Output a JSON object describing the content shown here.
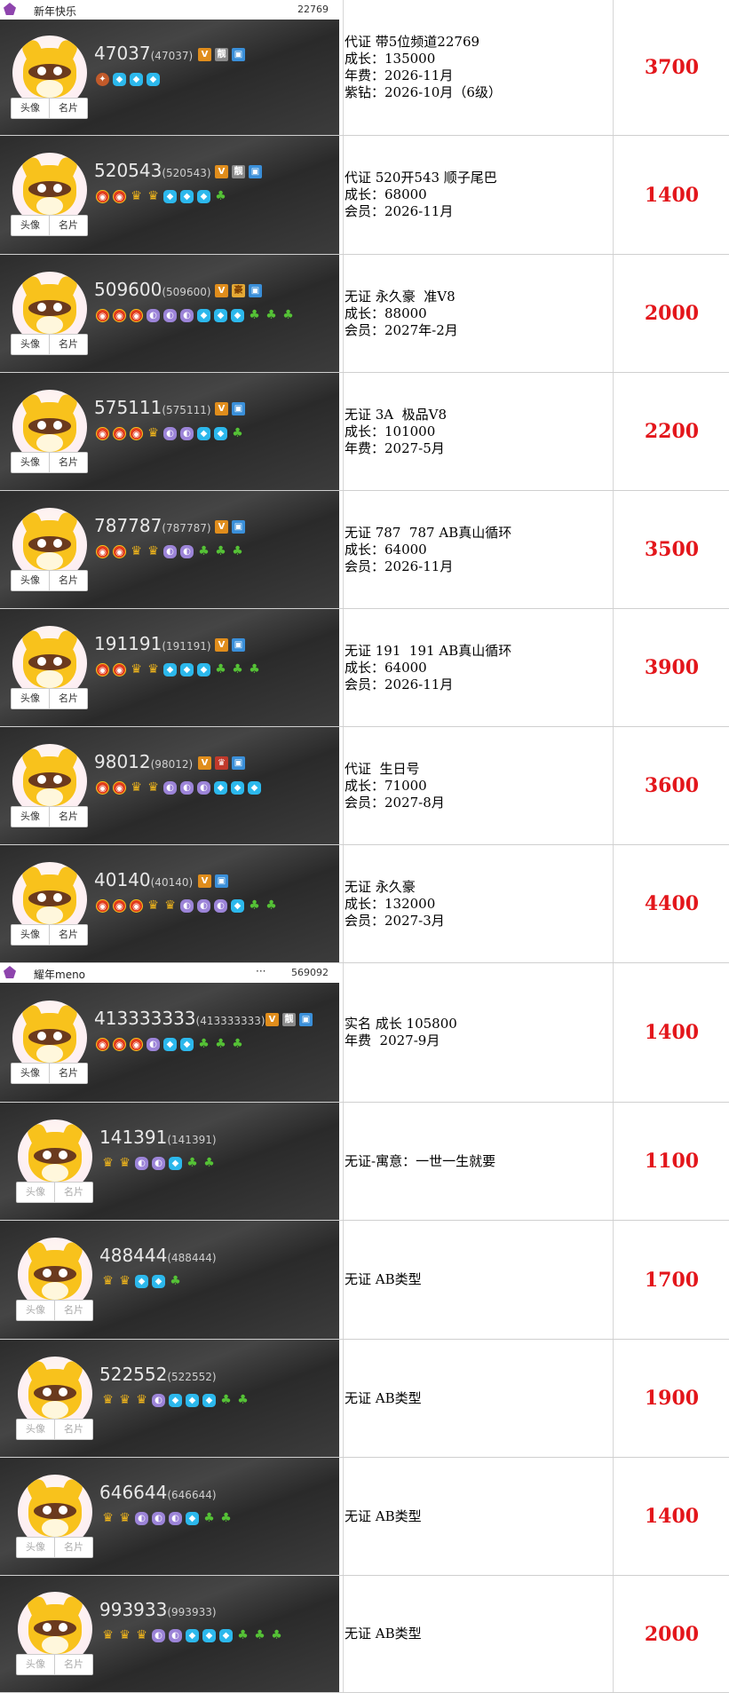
{
  "colors": {
    "price": "#e3161b",
    "dark_bg": "#2f2f2f"
  },
  "rows": [
    {
      "topbar": {
        "nick": "新年快乐",
        "num": "22769"
      },
      "uid": "47037",
      "uid_paren": "(47037)",
      "tags": [
        "v",
        "liang",
        "card"
      ],
      "icons": [
        "bird",
        "star",
        "star",
        "star"
      ],
      "lines": [
        "代证 带5位频道22769",
        "成长：135000",
        "年费：2026-11月",
        "紫钻：2026-10月（6级）"
      ],
      "price": "3700"
    },
    {
      "uid": "520543",
      "uid_paren": "(520543)",
      "tags": [
        "v",
        "liang",
        "card"
      ],
      "icons": [
        "sun",
        "sun",
        "crown",
        "crown",
        "star",
        "star",
        "star",
        "leaf"
      ],
      "lines": [
        "代证 520开543 顺子尾巴",
        "成长：68000",
        "会员：2026-11月"
      ],
      "price": "1400"
    },
    {
      "uid": "509600",
      "uid_paren": "(509600)",
      "tags": [
        "v",
        "hao",
        "card"
      ],
      "icons": [
        "sun",
        "sun",
        "sun",
        "moon",
        "moon",
        "moon",
        "star",
        "star",
        "star",
        "leaf",
        "leaf",
        "leaf"
      ],
      "lines": [
        "无证 永久豪  准V8",
        "成长：88000",
        "会员：2027年-2月"
      ],
      "price": "2000"
    },
    {
      "uid": "575111",
      "uid_paren": "(575111)",
      "tags": [
        "v",
        "card"
      ],
      "icons": [
        "sun",
        "sun",
        "sun",
        "crown",
        "moon",
        "moon",
        "star",
        "star",
        "leaf"
      ],
      "lines": [
        "无证 3A  极品V8",
        "成长：101000",
        "年费：2027-5月"
      ],
      "price": "2200"
    },
    {
      "uid": "787787",
      "uid_paren": "(787787)",
      "tags": [
        "v",
        "card"
      ],
      "icons": [
        "sun",
        "sun",
        "crown",
        "crown",
        "moon",
        "moon",
        "leaf",
        "leaf",
        "leaf"
      ],
      "lines": [
        "无证 787  787 AB真山循环",
        "成长：64000",
        "会员：2026-11月"
      ],
      "price": "3500"
    },
    {
      "uid": "191191",
      "uid_paren": "(191191)",
      "tags": [
        "v",
        "card"
      ],
      "icons": [
        "sun",
        "sun",
        "crown",
        "crown",
        "star",
        "star",
        "star",
        "leaf",
        "leaf",
        "leaf"
      ],
      "lines": [
        "无证 191  191 AB真山循环",
        "成长：64000",
        "会员：2026-11月"
      ],
      "price": "3900"
    },
    {
      "uid": "98012",
      "uid_paren": "(98012)",
      "tags": [
        "v",
        "cake",
        "card"
      ],
      "icons": [
        "sun",
        "sun",
        "crown",
        "crown",
        "moon",
        "moon",
        "moon",
        "star",
        "star",
        "star"
      ],
      "lines": [
        "代证  生日号",
        "成长：71000",
        "会员：2027-8月"
      ],
      "price": "3600"
    },
    {
      "uid": "40140",
      "uid_paren": "(40140)",
      "tags": [
        "v",
        "card"
      ],
      "icons": [
        "sun",
        "sun",
        "sun",
        "crown",
        "crown",
        "moon",
        "moon",
        "moon",
        "star",
        "leaf",
        "leaf"
      ],
      "lines": [
        "无证 永久豪",
        "成长：132000",
        "会员：2027-3月"
      ],
      "price": "4400"
    },
    {
      "topbar": {
        "nick": "耀年meno",
        "num": "569092",
        "dots": "···"
      },
      "uid": "413333333",
      "uid_paren": "(413333333)",
      "tags": [
        "v",
        "liang",
        "card"
      ],
      "icons": [
        "sun",
        "sun",
        "sun",
        "moon",
        "star",
        "star",
        "leaf",
        "leaf",
        "leaf"
      ],
      "lines": [
        "实名 成长 105800",
        "年费  2027-9月"
      ],
      "price": "1400"
    },
    {
      "uid": "141391",
      "uid_paren": "(141391)",
      "tags": [],
      "icons": [
        "crown",
        "crown",
        "moon",
        "moon",
        "star",
        "leaf",
        "leaf"
      ],
      "lines": [
        "无证-寓意：一世一生就要"
      ],
      "price": "1100",
      "faded": true
    },
    {
      "uid": "488444",
      "uid_paren": "(488444)",
      "tags": [],
      "icons": [
        "crown",
        "crown",
        "star",
        "star",
        "leaf"
      ],
      "lines": [
        "无证 AB类型"
      ],
      "price": "1700",
      "faded": true
    },
    {
      "uid": "522552",
      "uid_paren": "(522552)",
      "tags": [],
      "icons": [
        "crown",
        "crown",
        "crown",
        "moon",
        "star",
        "star",
        "star",
        "leaf",
        "leaf"
      ],
      "lines": [
        "无证 AB类型"
      ],
      "price": "1900",
      "faded": true
    },
    {
      "uid": "646644",
      "uid_paren": "(646644)",
      "tags": [],
      "icons": [
        "crown",
        "crown",
        "moon",
        "moon",
        "moon",
        "star",
        "leaf",
        "leaf"
      ],
      "lines": [
        "无证 AB类型"
      ],
      "price": "1400",
      "faded": true
    },
    {
      "uid": "993933",
      "uid_paren": "(993933)",
      "tags": [],
      "icons": [
        "crown",
        "crown",
        "crown",
        "moon",
        "moon",
        "star",
        "star",
        "star",
        "leaf",
        "leaf",
        "leaf"
      ],
      "lines": [
        "无证 AB类型"
      ],
      "price": "2000",
      "faded": true
    }
  ],
  "labels": {
    "avatar_btn": "头像",
    "card_btn": "名片",
    "tag_v": "V",
    "tag_liang": "靓",
    "tag_hao": "豪",
    "tag_card": "▣",
    "tag_cake": "♛"
  }
}
